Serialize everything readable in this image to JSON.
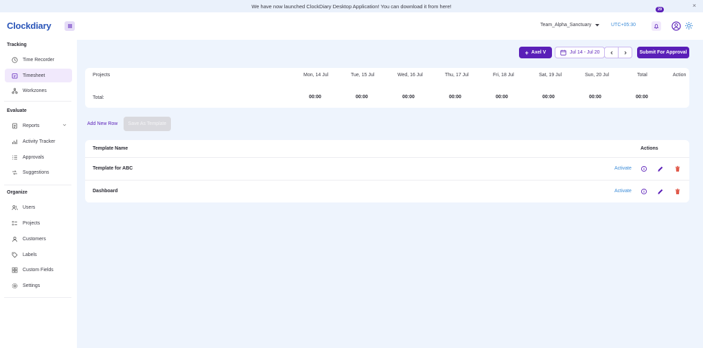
{
  "banner": {
    "text": "We have now launched ClockDiary Desktop Application! You can download it from here!",
    "close": "×"
  },
  "header": {
    "logo": "Clockdiary",
    "team": "Team_Alpha_Sanctuary",
    "timezone": "UTC+05:30",
    "notifications": "29"
  },
  "sidebar": {
    "sections": [
      {
        "title": "Tracking",
        "items": [
          {
            "label": "Time Recorder",
            "icon": "clock-icon"
          },
          {
            "label": "Timesheet",
            "icon": "timesheet-icon",
            "active": true
          },
          {
            "label": "Workzones",
            "icon": "workzones-icon"
          }
        ]
      },
      {
        "title": "Evaluate",
        "items": [
          {
            "label": "Reports",
            "icon": "reports-icon"
          },
          {
            "label": "Activity Tracker",
            "icon": "activity-icon"
          },
          {
            "label": "Approvals",
            "icon": "approvals-icon"
          },
          {
            "label": "Suggestions",
            "icon": "suggestions-icon"
          }
        ]
      },
      {
        "title": "Organize",
        "items": [
          {
            "label": "Users",
            "icon": "users-icon"
          },
          {
            "label": "Projects",
            "icon": "projects-icon"
          },
          {
            "label": "Customers",
            "icon": "customers-icon"
          },
          {
            "label": "Labels",
            "icon": "labels-icon"
          },
          {
            "label": "Custom Fields",
            "icon": "custom-fields-icon"
          },
          {
            "label": "Settings",
            "icon": "settings-icon"
          }
        ]
      }
    ]
  },
  "toolbar": {
    "user_button": "Axel V",
    "date_range": "Jul 14 - Jul 20",
    "submit": "Submit For Approval"
  },
  "timesheet": {
    "headers": [
      "Projects",
      "Mon, 14 Jul",
      "Tue, 15 Jul",
      "Wed, 16 Jul",
      "Thu, 17 Jul",
      "Fri, 18 Jul",
      "Sat, 19 Jul",
      "Sun, 20 Jul",
      "Total",
      "Action"
    ],
    "total_label": "Total:",
    "totals": [
      "00:00",
      "00:00",
      "00:00",
      "00:00",
      "00:00",
      "00:00",
      "00:00",
      "00:00"
    ]
  },
  "actions": {
    "add_row": "Add New Row",
    "save_template": "Save As Template"
  },
  "templates": {
    "header_name": "Template Name",
    "header_actions": "Actions",
    "rows": [
      {
        "name": "Template for ABC",
        "activate": "Activate"
      },
      {
        "name": "Dashboard",
        "activate": "Activate"
      }
    ]
  },
  "colors": {
    "accent": "#5a1fb8",
    "link": "#3a8bd8",
    "delete": "#e0594a",
    "background": "#eef4fd"
  }
}
